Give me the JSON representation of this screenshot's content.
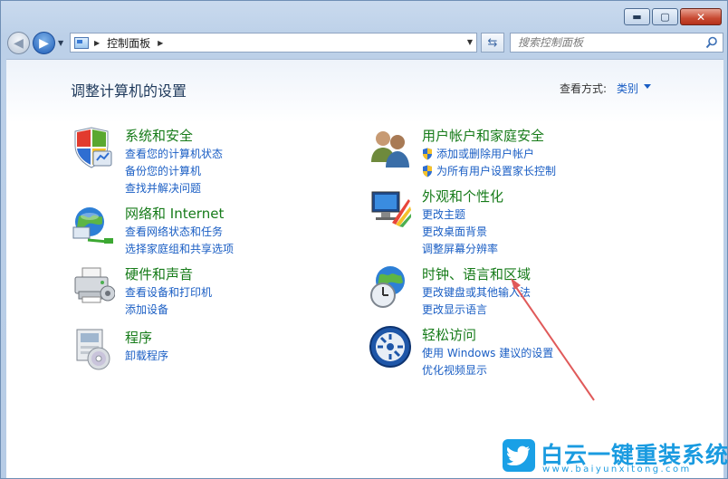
{
  "window": {
    "buttons": {
      "minimize": "▬",
      "maximize": "▢",
      "close": "✕"
    }
  },
  "nav": {
    "back_icon": "back-arrow-icon",
    "forward_icon": "forward-arrow-icon",
    "address": {
      "icon": "control-panel-icon",
      "path": "控制面板"
    },
    "refresh_icon": "refresh-icon",
    "search": {
      "placeholder": "搜索控制面板",
      "icon": "search-icon"
    }
  },
  "main": {
    "title": "调整计算机的设置",
    "view_by_label": "查看方式:",
    "view_by_value": "类别",
    "categories": [
      {
        "title": "系统和安全",
        "icon": "system-security-icon",
        "links": [
          "查看您的计算机状态",
          "备份您的计算机",
          "查找并解决问题"
        ]
      },
      {
        "title": "网络和 Internet",
        "icon": "network-internet-icon",
        "links": [
          "查看网络状态和任务",
          "选择家庭组和共享选项"
        ]
      },
      {
        "title": "硬件和声音",
        "icon": "hardware-sound-icon",
        "links": [
          "查看设备和打印机",
          "添加设备"
        ]
      },
      {
        "title": "程序",
        "icon": "programs-icon",
        "links": [
          "卸载程序"
        ]
      },
      {
        "title": "用户帐户和家庭安全",
        "icon": "user-accounts-icon",
        "links": [
          "添加或删除用户帐户",
          "为所有用户设置家长控制"
        ]
      },
      {
        "title": "外观和个性化",
        "icon": "appearance-icon",
        "links": [
          "更改主题",
          "更改桌面背景",
          "调整屏幕分辨率"
        ]
      },
      {
        "title": "时钟、语言和区域",
        "icon": "clock-language-region-icon",
        "links": [
          "更改键盘或其他输入法",
          "更改显示语言"
        ]
      },
      {
        "title": "轻松访问",
        "icon": "ease-of-access-icon",
        "links": [
          "使用 Windows 建议的设置",
          "优化视频显示"
        ]
      }
    ]
  },
  "watermark": {
    "name": "白云一键重装系统",
    "url": "www.baiyunxitong.com",
    "icon": "twitter-bird-icon"
  },
  "colors": {
    "link": "#1a5ec4",
    "category_title": "#167b19",
    "title": "#1e395b",
    "annotation_arrow": "#e05a5a"
  }
}
